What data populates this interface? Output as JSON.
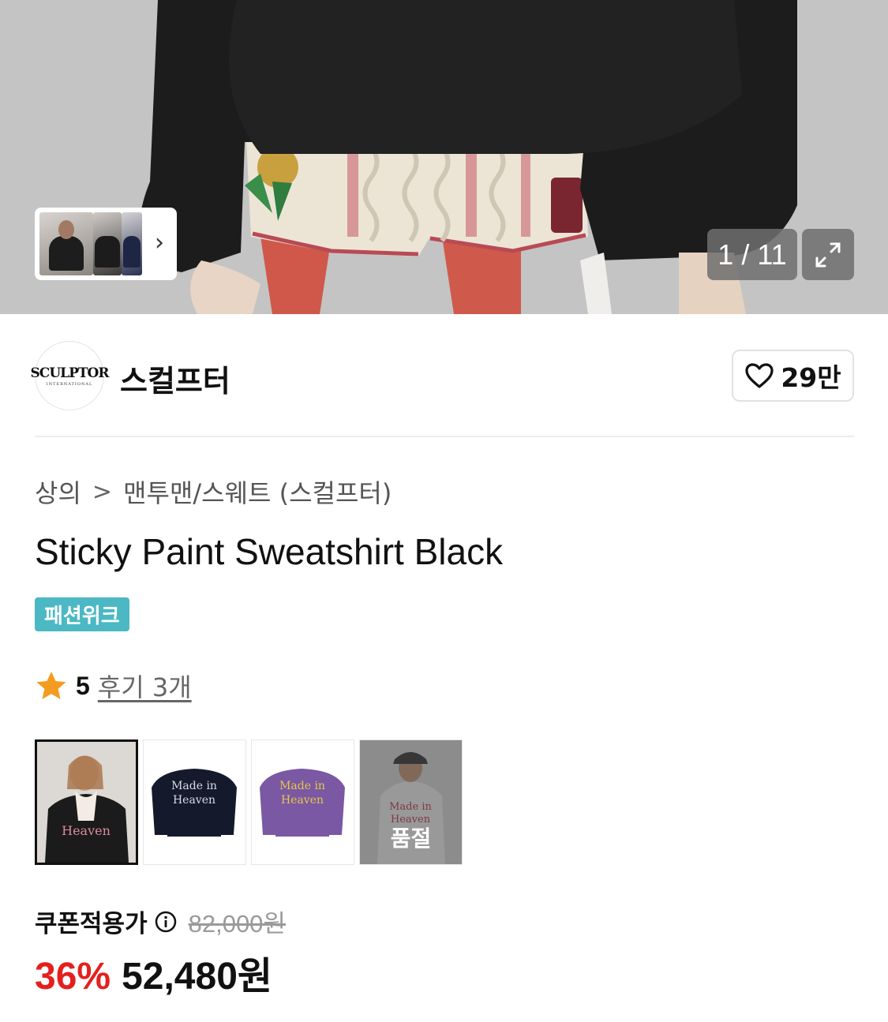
{
  "gallery": {
    "counter": "1 / 11",
    "thumb_strip_next": "›"
  },
  "brand": {
    "logo_text": "SCULPTOR",
    "logo_subtext": "INTERNATIONAL",
    "name": "스컬프터",
    "likes": "29만"
  },
  "breadcrumb": {
    "category": "상의",
    "separator": ">",
    "subcategory": "맨투맨/스웨트 (스컬프터)"
  },
  "product": {
    "title": "Sticky Paint Sweatshirt Black",
    "badge": "패션위크"
  },
  "rating": {
    "score": "5",
    "reviews": "후기 3개"
  },
  "options": [
    {
      "name": "black-model",
      "selected": true,
      "sold_out": false
    },
    {
      "name": "navy",
      "selected": false,
      "sold_out": false
    },
    {
      "name": "purple",
      "selected": false,
      "sold_out": false
    },
    {
      "name": "grey-model",
      "selected": false,
      "sold_out": true,
      "sold_out_label": "품절"
    }
  ],
  "price": {
    "coupon_label": "쿠폰적용가",
    "original": "82,000원",
    "discount": "36%",
    "final": "52,480원"
  },
  "colors": {
    "badge": "#4bb8c4",
    "discount": "#e4201f",
    "star": "#f39c1f"
  }
}
